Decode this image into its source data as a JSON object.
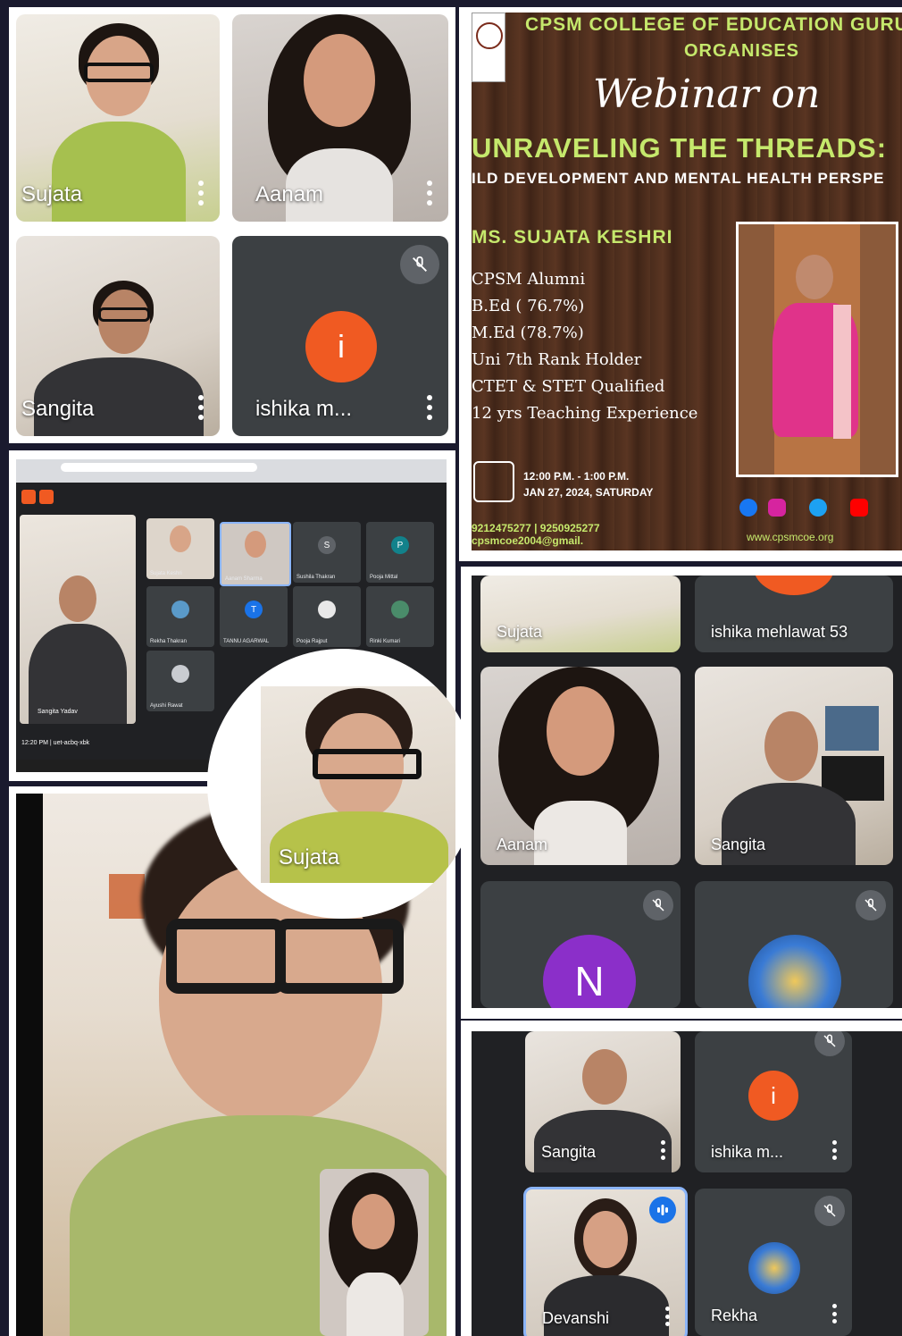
{
  "poster": {
    "college_line": "CPSM COLLEGE OF EDUCATION GURUG",
    "organises": "ORGANISES",
    "webinar_on": "Webinar on",
    "title": "UNRAVELING THE THREADS:",
    "subtitle": "ILD DEVELOPMENT AND MENTAL HEALTH PERSPE",
    "speaker": "MS. SUJATA KESHRI",
    "credentials": [
      "CPSM Alumni",
      "B.Ed ( 76.7%)",
      "M.Ed (78.7%)",
      "Uni 7th Rank Holder",
      "CTET & STET Qualified",
      "12 yrs Teaching Experience"
    ],
    "time": "12:00 P.M. - 1:00 P.M.",
    "date": "JAN 27, 2024, SATURDAY",
    "phones": "9212475277  |  9250925277",
    "email": "cpsmcoe2004@gmail.",
    "website": "www.cpsmcoe.org"
  },
  "top_grid": {
    "tiles": [
      {
        "name": "Sujata"
      },
      {
        "name": "Aanam"
      },
      {
        "name": "Sangita"
      },
      {
        "name": "ishika m...",
        "initial": "i"
      }
    ]
  },
  "browser_call": {
    "participants": [
      "Sujata Keshri",
      "Aanam Sharma",
      "Sushila Thakran",
      "Pooja Mittal",
      "Rekha Thakran",
      "TANNU AGARWAL",
      "Pooja Rajput",
      "Rinki Kumari",
      "Ayushi Rawat"
    ],
    "initials": {
      "sushila": "S",
      "pooja": "P",
      "tannu": "T"
    },
    "self_name": "Sangita Yadav",
    "clock": "12:20 PM  |  uet-acbq-xbk"
  },
  "spotlight": {
    "name": "Sujata"
  },
  "mid_right_grid": {
    "tiles": [
      {
        "name": "Sujata"
      },
      {
        "name": "ishika mehlawat 53"
      },
      {
        "name": "Aanam"
      },
      {
        "name": "Sangita"
      },
      {
        "name": "",
        "initial": "N"
      },
      {
        "name": ""
      }
    ]
  },
  "bottom_right_grid": {
    "tiles": [
      {
        "name": "Sangita"
      },
      {
        "name": "ishika m...",
        "initial": "i"
      },
      {
        "name": "Devanshi"
      },
      {
        "name": "Rekha"
      }
    ]
  },
  "colors": {
    "accent_orange": "#f05a22",
    "purple": "#8b2fc9",
    "poster_green": "#c5e86c"
  },
  "icons": [
    "kebab-menu-icon",
    "mic-off-icon",
    "audio-level-icon",
    "facebook-icon",
    "instagram-icon",
    "twitter-icon",
    "youtube-icon",
    "calendar-icon",
    "college-logo"
  ]
}
